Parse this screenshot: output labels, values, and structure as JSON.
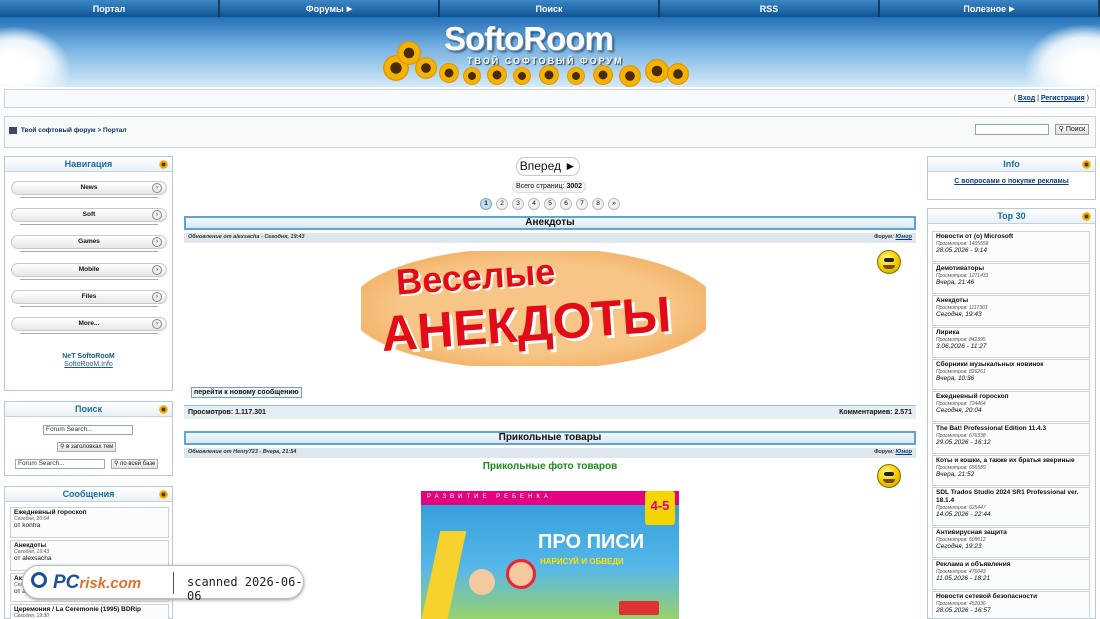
{
  "topnav": [
    {
      "label": "Портал",
      "has_arrow": false
    },
    {
      "label": "Форумы",
      "has_arrow": true
    },
    {
      "label": "Поиск",
      "has_arrow": false
    },
    {
      "label": "RSS",
      "has_arrow": false
    },
    {
      "label": "Полезное",
      "has_arrow": true
    }
  ],
  "banner": {
    "logo": "SoftoRoom",
    "slogan": "ТВОЙ СОФТОВЫЙ ФОРУМ"
  },
  "login": {
    "open": "(",
    "login": "Вход",
    "sep": "|",
    "register": "Регистрация",
    "close": ")"
  },
  "breadcrumb": {
    "home": "Твой софтовый форум",
    "sep": ">",
    "current": "Портал"
  },
  "header_search": {
    "button": "Поиск"
  },
  "nav_block": {
    "title": "Навигация",
    "items": [
      "News",
      "Soft",
      "Games",
      "Mobile",
      "Files",
      "More..."
    ],
    "net_title": "NeT SoftoRooM",
    "net_link": "SoftoRooM.Info"
  },
  "search_block": {
    "title": "Поиск",
    "input1": "Forum Search...",
    "btn1": "в заголовках тем",
    "input2": "Forum Search...",
    "btn2": "по всей базе"
  },
  "messages_block": {
    "title": "Сообщения",
    "items": [
      {
        "title": "Ежедневный гороскоп",
        "date": "Сегодня, 20:04",
        "author": "от kontra"
      },
      {
        "title": "Анекдоты",
        "date": "Сегодня, 19:43",
        "author": "от alexsacha"
      },
      {
        "title": "Ак...",
        "date": "Сег...",
        "author": "от а..."
      },
      {
        "title": "Церемония / La Ceremonie (1995) BDRip",
        "date": "Сегодня, 19:30",
        "author": ""
      }
    ]
  },
  "pager": {
    "next": "Вперед ►",
    "total_label": "Всего страниц:",
    "total": "3002",
    "pages": [
      "1",
      "2",
      "3",
      "4",
      "5",
      "6",
      "7",
      "8",
      "»"
    ]
  },
  "post1": {
    "title": "Анекдоты",
    "meta": "Обновление от alexsacha - Сегодня, 19:43",
    "forum_label": "Форум:",
    "forum": "Юмор",
    "image_l1": "Веселые",
    "image_l2": "АНЕКДОТЫ",
    "goto_new": "перейти к новому сообщению",
    "views_label": "Просмотров:",
    "views": "1.117.301",
    "comments_label": "Комментариев:",
    "comments": "2.571"
  },
  "post2": {
    "title": "Прикольные товары",
    "meta": "Обновление от Henry723 - Вчера, 21:54",
    "forum_label": "Форум:",
    "forum": "Юмор",
    "heading": "Прикольные фото товаров",
    "book_strip": "РАЗВИТИЕ РЕБЕНКА",
    "book_age": "4-5",
    "book_title": "ПРО ПИСИ",
    "book_sub": "НАРИСУЙ И ОБВЕДИ"
  },
  "info_block": {
    "title": "Info",
    "link": "С вопросами о покупке рекламы"
  },
  "top30_block": {
    "title": "Top 30",
    "views_label": "Просмотров:",
    "items": [
      {
        "title": "Новости от (о) Microsoft",
        "views": "1405558",
        "date": "28.05.2026 - 9:14"
      },
      {
        "title": "Демотиваторы",
        "views": "1271431",
        "date": "Вчера, 21:46"
      },
      {
        "title": "Анекдоты",
        "views": "1117301",
        "date": "Сегодня, 19:43"
      },
      {
        "title": "Лирика",
        "views": "842395",
        "date": "3.06.2026 - 11:27"
      },
      {
        "title": "Сборники музыкальных новинок",
        "views": "826261",
        "date": "Вчера, 10:36"
      },
      {
        "title": "Ежедневный гороскоп",
        "views": "724464",
        "date": "Сегодня, 20:04"
      },
      {
        "title": "The Bat! Professional Edition 11.4.3",
        "views": "676338",
        "date": "29.05.2026 - 16:12"
      },
      {
        "title": "Коты и кошки, а также их братья звериные",
        "views": "656589",
        "date": "Вчера, 21:52"
      },
      {
        "title": "SDL Trados Studio 2024 SR1 Professional ver. 18.1.4",
        "views": "625447",
        "date": "14.05.2026 - 22:44"
      },
      {
        "title": "Антивирусная защита",
        "views": "509612",
        "date": "Сегодня, 19:23"
      },
      {
        "title": "Реклама и объявления",
        "views": "476043",
        "date": "11.05.2026 - 18:21"
      },
      {
        "title": "Новости сетевой безопасности",
        "views": "452036",
        "date": "28.05.2026 - 16:57"
      }
    ]
  },
  "watermark": {
    "brand": "PC",
    "brand2": "risk.com",
    "scanned": "scanned 2026-06-06"
  }
}
